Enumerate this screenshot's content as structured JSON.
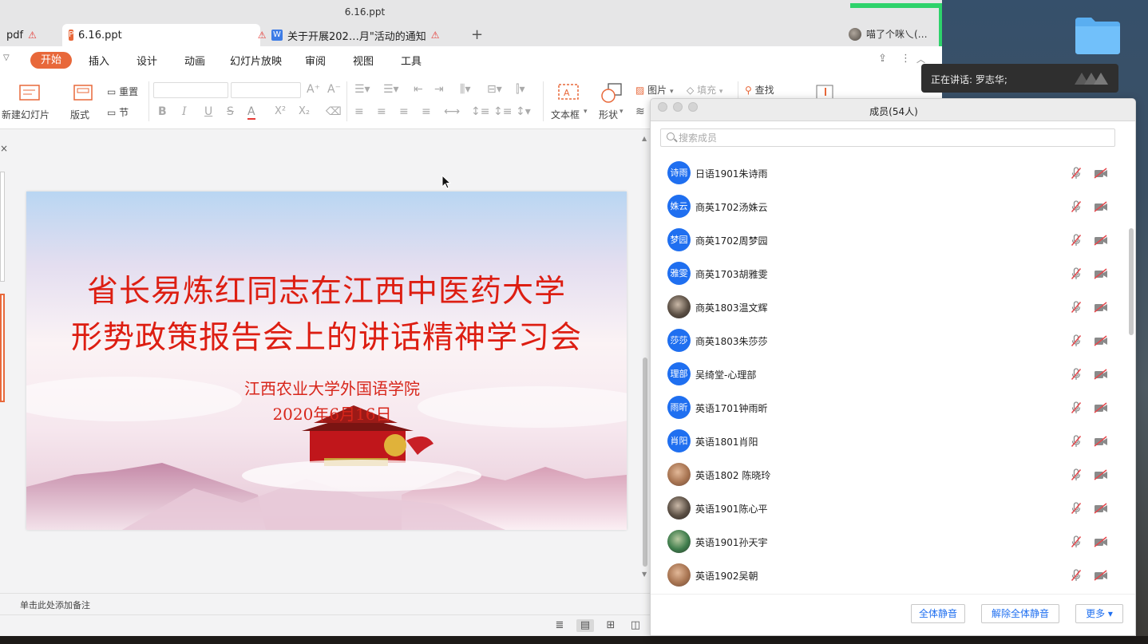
{
  "window": {
    "title": "6.16.ppt"
  },
  "tabs": [
    {
      "label": "pdf",
      "warning": "⚠"
    },
    {
      "label": "6.16.ppt",
      "warning": "⚠",
      "close": "✕"
    },
    {
      "label": "关于开展202…月\"活动的通知",
      "warning": "⚠"
    }
  ],
  "tab_add": "+",
  "user": {
    "name": "喵了个咪乀(…"
  },
  "menu": {
    "items": [
      "开始",
      "插入",
      "设计",
      "动画",
      "幻灯片放映",
      "审阅",
      "视图",
      "工具"
    ]
  },
  "ribbon": {
    "new_slide": "新建幻灯片",
    "layout": "版式",
    "reset": "重置",
    "section": "节",
    "text_box": "文本框",
    "shape": "形状",
    "picture": "图片",
    "fill": "填充",
    "find": "查找"
  },
  "slide": {
    "title_line1": "省长易炼红同志在江西中医药大学",
    "title_line2": "形势政策报告会上的讲话精神学习会",
    "subtitle_line1": "江西农业大学外国语学院",
    "subtitle_line2": "2020年6月16日"
  },
  "notes_placeholder": "单击此处添加备注",
  "speaking": {
    "text": "正在讲话: 罗志华;"
  },
  "members_panel": {
    "title": "成员(54人)",
    "search_placeholder": "搜索成员",
    "members": [
      {
        "avatar": "诗雨",
        "name": "日语1901朱诗雨",
        "photo": false
      },
      {
        "avatar": "姝云",
        "name": "商英1702汤姝云",
        "photo": false
      },
      {
        "avatar": "梦园",
        "name": "商英1702周梦园",
        "photo": false
      },
      {
        "avatar": "雅雯",
        "name": "商英1703胡雅雯",
        "photo": false
      },
      {
        "avatar": "",
        "name": "商英1803温文辉",
        "photo": true
      },
      {
        "avatar": "莎莎",
        "name": "商英1803朱莎莎",
        "photo": false
      },
      {
        "avatar": "理部",
        "name": "吴绮堂-心理部",
        "photo": false
      },
      {
        "avatar": "雨昕",
        "name": "英语1701钟雨昕",
        "photo": false
      },
      {
        "avatar": "肖阳",
        "name": "英语1801肖阳",
        "photo": false
      },
      {
        "avatar": "",
        "name": "英语1802 陈晓玲",
        "photo": true
      },
      {
        "avatar": "",
        "name": "英语1901陈心平",
        "photo": true
      },
      {
        "avatar": "",
        "name": "英语1901孙天宇",
        "photo": true
      },
      {
        "avatar": "",
        "name": "英语1902吴朝",
        "photo": true
      }
    ],
    "buttons": {
      "mute_all": "全体静音",
      "unmute_all": "解除全体静音",
      "more": "更多 ▾"
    }
  },
  "colors": {
    "accent": "#e8683a",
    "slide_title": "#dd1e12",
    "member_avatar": "#1f6ff0",
    "highlight_green": "#2ed26b"
  }
}
